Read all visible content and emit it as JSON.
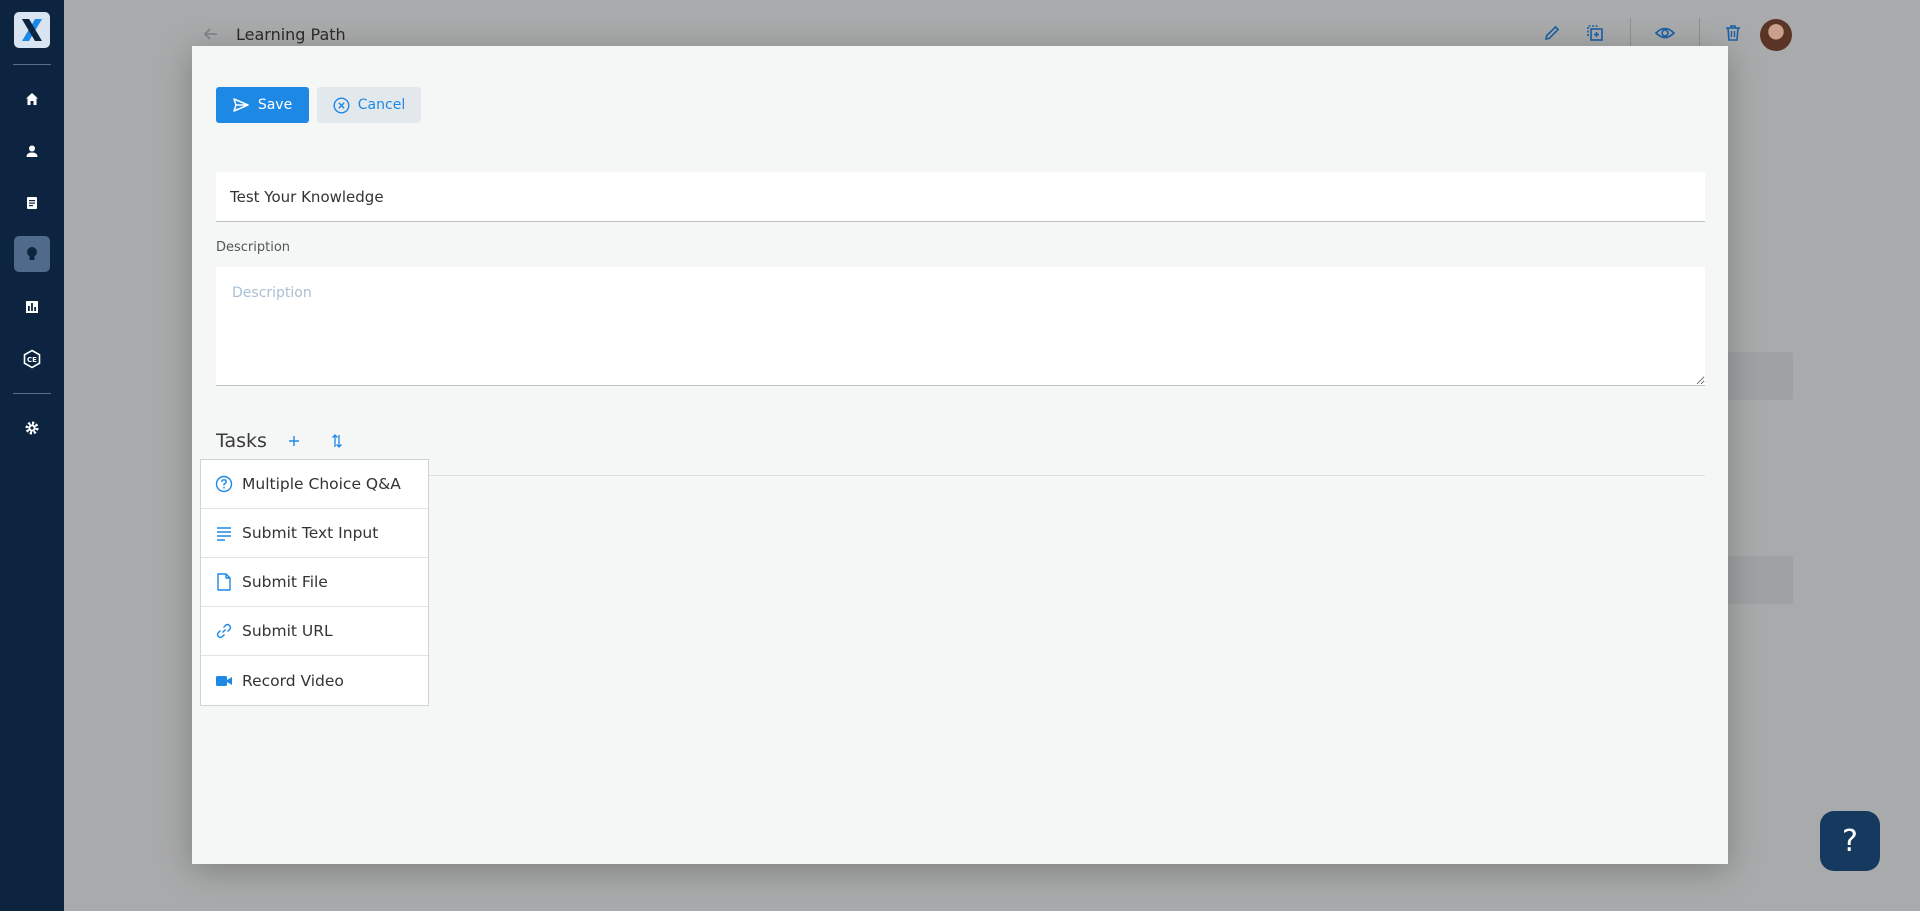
{
  "sidebar": {
    "logo_icon": "x-logo-icon",
    "items": [
      {
        "icon": "home-icon"
      },
      {
        "icon": "user-icon"
      },
      {
        "icon": "book-icon"
      },
      {
        "icon": "lightbulb-icon",
        "active": true
      },
      {
        "icon": "bar-chart-icon"
      },
      {
        "icon": "certificate-icon"
      },
      {
        "icon": "gear-icon"
      }
    ]
  },
  "background_page": {
    "title": "Learning Path"
  },
  "modal": {
    "save_label": "Save",
    "cancel_label": "Cancel",
    "title_value": "Test Your Knowledge",
    "description_label": "Description",
    "description_placeholder": "Description",
    "tasks_label": "Tasks"
  },
  "task_menu": [
    {
      "label": "Multiple Choice Q&A",
      "icon": "question-circle-icon"
    },
    {
      "label": "Submit Text Input",
      "icon": "text-lines-icon"
    },
    {
      "label": "Submit File",
      "icon": "file-icon"
    },
    {
      "label": "Submit URL",
      "icon": "link-icon"
    },
    {
      "label": "Record Video",
      "icon": "video-camera-icon"
    }
  ],
  "help": {
    "label": "?"
  },
  "colors": {
    "accent": "#1e88e5",
    "sidebar": "#0d2440",
    "help_button": "#163a5f"
  }
}
